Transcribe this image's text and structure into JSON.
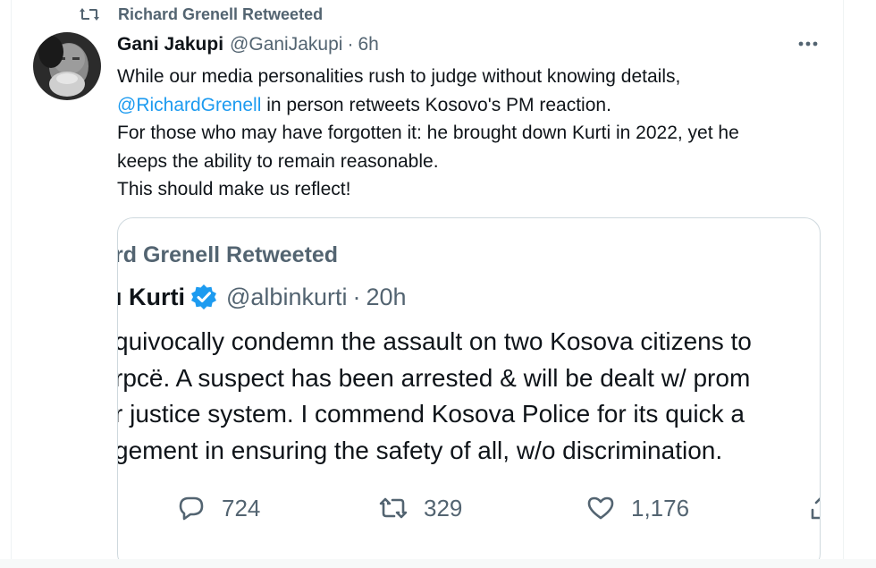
{
  "retweet_banner": {
    "label": "Richard Grenell Retweeted"
  },
  "tweet": {
    "display_name": "Gani Jakupi",
    "handle": "@GaniJakupi",
    "separator": "·",
    "time": "6h",
    "more_label": "···",
    "lines": [
      {
        "pre": "While our media personalities rush to judge without knowing details,",
        "mention": "",
        "post": ""
      },
      {
        "pre": "",
        "mention": "@RichardGrenell",
        "post": " in person retweets Kosovo's PM reaction."
      },
      {
        "pre": "For those who may have forgotten it: he brought down Kurti in 2022, yet he",
        "mention": "",
        "post": ""
      },
      {
        "pre": "keeps the ability to remain reasonable.",
        "mention": "",
        "post": ""
      },
      {
        "pre": "This should make us reflect!",
        "mention": "",
        "post": ""
      }
    ]
  },
  "quoted": {
    "retweet_label": "rd Grenell Retweeted",
    "display_name": "ı Kurti",
    "handle": "@albinkurti",
    "separator": "·",
    "time": "20h",
    "lines": [
      "quivocally condemn the assault on two Kosova citizens to",
      "rpcë. A suspect has been arrested & will be dealt w/ prom",
      "r justice system. I commend Kosova Police for its quick a",
      "gement in ensuring the safety of all, w/o discrimination."
    ],
    "actions": {
      "replies": "724",
      "retweets": "329",
      "likes": "1,176"
    }
  },
  "icons": {
    "retweet": "retweet-icon",
    "verified": "verified-badge-icon",
    "reply": "reply-icon",
    "like": "heart-icon",
    "share": "share-icon",
    "more": "more-icon"
  },
  "colors": {
    "accent": "#1d9bf0",
    "secondary_text": "#536471",
    "primary_text": "#0f1419",
    "border": "#cfd9de"
  }
}
